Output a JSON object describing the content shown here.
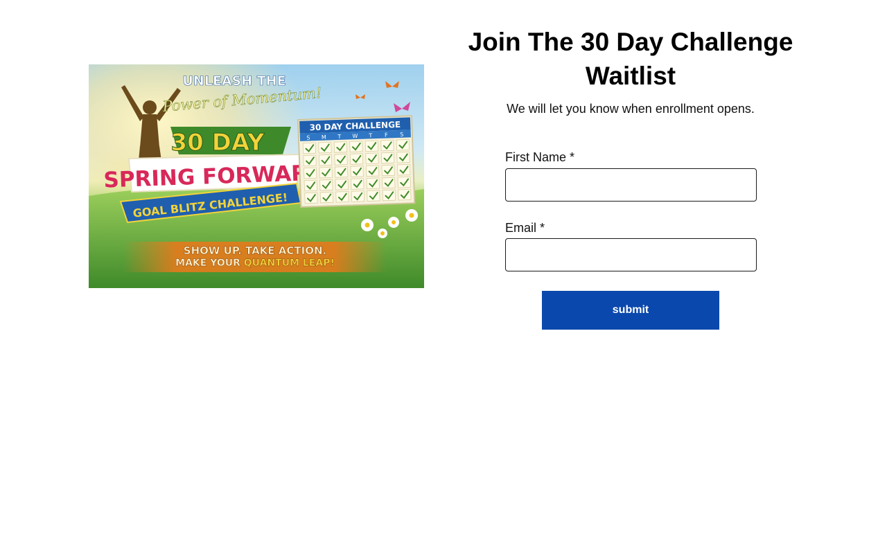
{
  "banner": {
    "headline_top": "UNLEASH THE",
    "headline_script": "Power of Momentum!",
    "days": "30 DAY",
    "main_title": "SPRING FORWARD",
    "ribbon": "GOAL BLITZ CHALLENGE!",
    "calendar_title": "30 DAY CHALLENGE",
    "calendar_days": [
      "S",
      "M",
      "T",
      "W",
      "T",
      "F",
      "S"
    ],
    "tagline_line1": "SHOW UP. TAKE ACTION.",
    "tagline_line2_a": "MAKE YOUR ",
    "tagline_line2_b": "QUANTUM LEAP!",
    "colors": {
      "pink": "#d8285a",
      "blue": "#1f5fae",
      "green": "#3e8a2a",
      "gold": "#f2d33a"
    }
  },
  "form": {
    "title": "Join The 30 Day Challenge Waitlist",
    "subtitle": "We will let you know when enrollment opens.",
    "first_name_label": "First Name *",
    "first_name_value": "",
    "email_label": "Email *",
    "email_value": "",
    "submit_label": "submit",
    "button_color": "#0a48ad"
  }
}
